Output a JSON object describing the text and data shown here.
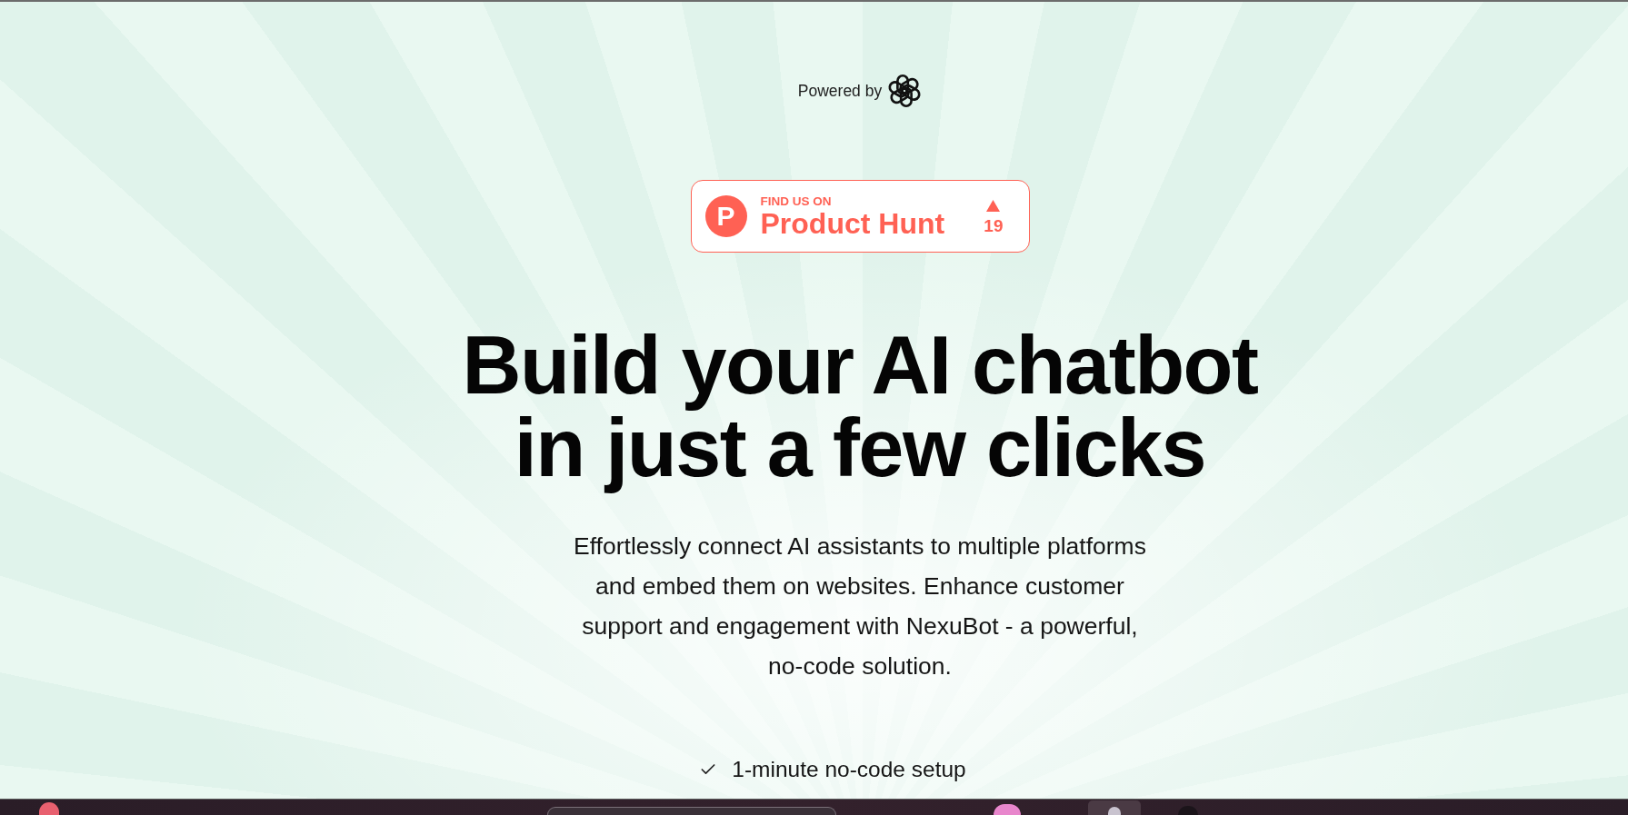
{
  "powered_by": {
    "label": "Powered by"
  },
  "product_hunt_badge": {
    "logo_letter": "P",
    "eyebrow": "FIND US ON",
    "title": "Product Hunt",
    "upvote_count": "19"
  },
  "hero": {
    "heading": "Build your AI chatbot in just a few clicks",
    "description": "Effortlessly connect AI assistants to multiple platforms and embed them on websites. Enhance customer support and engagement with NexuBot - a powerful, no-code solution."
  },
  "features": [
    {
      "label": "1-minute no-code setup"
    }
  ]
}
